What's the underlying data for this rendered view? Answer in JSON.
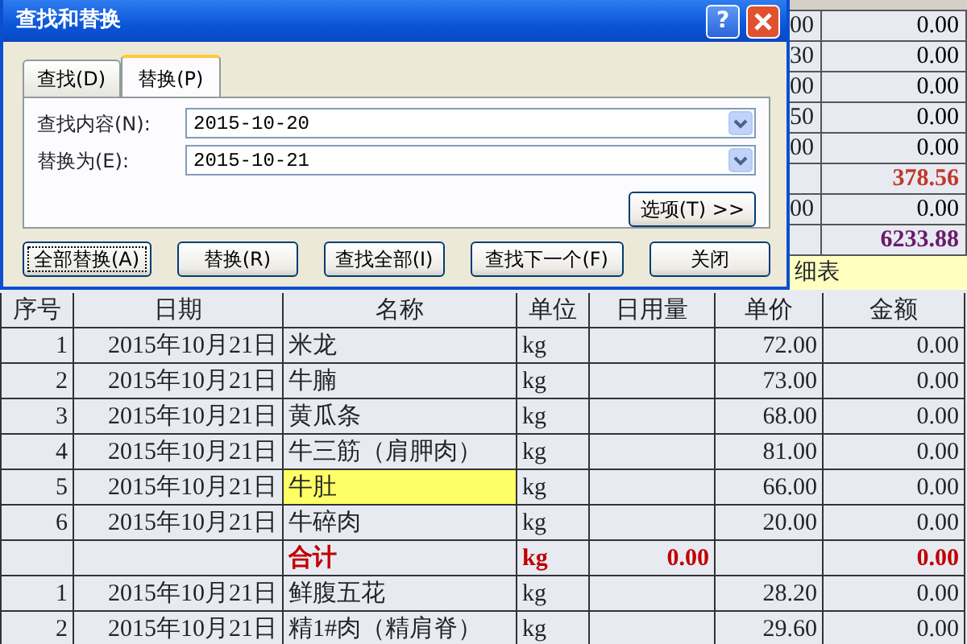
{
  "dialog": {
    "title": "查找和替换",
    "help_button": "?",
    "tabs": [
      {
        "label": "查找(D)",
        "selected": false
      },
      {
        "label": "替换(P)",
        "selected": true
      }
    ],
    "fields": [
      {
        "label": "查找内容(N):",
        "value": "2015-10-20"
      },
      {
        "label": "替换为(E):",
        "value": "2015-10-21"
      }
    ],
    "options_button": "选项(T) >>",
    "buttons": [
      {
        "label": "全部替换(A)",
        "focused": true
      },
      {
        "label": "替换(R)",
        "focused": false
      },
      {
        "label": "查找全部(I)",
        "focused": false
      },
      {
        "label": "查找下一个(F)",
        "focused": false
      },
      {
        "label": "关闭",
        "focused": false
      }
    ]
  },
  "background_sheet": {
    "rows": [
      {
        "partial": "00",
        "amount": "0.00",
        "kind": "normal"
      },
      {
        "partial": "30",
        "amount": "0.00",
        "kind": "normal"
      },
      {
        "partial": "00",
        "amount": "0.00",
        "kind": "normal"
      },
      {
        "partial": "50",
        "amount": "0.00",
        "kind": "normal"
      },
      {
        "partial": "00",
        "amount": "0.00",
        "kind": "normal"
      },
      {
        "partial": "",
        "amount": "378.56",
        "kind": "subtotal"
      },
      {
        "partial": "00",
        "amount": "0.00",
        "kind": "normal"
      },
      {
        "partial": "",
        "amount": "6233.88",
        "kind": "total"
      }
    ],
    "banner": "细表"
  },
  "sheet": {
    "columns": [
      "序号",
      "日期",
      "名称",
      "单位",
      "日用量",
      "单价",
      "金额"
    ],
    "rows": [
      {
        "kind": "item",
        "highlighted": false,
        "cells": [
          "1",
          "2015年10月21日",
          "米龙",
          "kg",
          "",
          "72.00",
          "0.00"
        ]
      },
      {
        "kind": "item",
        "highlighted": false,
        "cells": [
          "2",
          "2015年10月21日",
          "牛腩",
          "kg",
          "",
          "73.00",
          "0.00"
        ]
      },
      {
        "kind": "item",
        "highlighted": false,
        "cells": [
          "3",
          "2015年10月21日",
          "黄瓜条",
          "kg",
          "",
          "68.00",
          "0.00"
        ]
      },
      {
        "kind": "item",
        "highlighted": false,
        "cells": [
          "4",
          "2015年10月21日",
          "牛三筋（肩胛肉）",
          "kg",
          "",
          "81.00",
          "0.00"
        ]
      },
      {
        "kind": "item",
        "highlighted": true,
        "cells": [
          "5",
          "2015年10月21日",
          "牛肚",
          "kg",
          "",
          "66.00",
          "0.00"
        ]
      },
      {
        "kind": "item",
        "highlighted": false,
        "cells": [
          "6",
          "2015年10月21日",
          "牛碎肉",
          "kg",
          "",
          "20.00",
          "0.00"
        ]
      },
      {
        "kind": "total",
        "highlighted": false,
        "cells": [
          "",
          "",
          "合计",
          "kg",
          "0.00",
          "",
          "0.00"
        ]
      },
      {
        "kind": "item",
        "highlighted": false,
        "cells": [
          "1",
          "2015年10月21日",
          "鲜腹五花",
          "kg",
          "",
          "28.20",
          "0.00"
        ]
      },
      {
        "kind": "item",
        "highlighted": false,
        "cells": [
          "2",
          "2015年10月21日",
          "精1#肉（精肩脊）",
          "kg",
          "",
          "29.60",
          "0.00"
        ]
      }
    ]
  }
}
